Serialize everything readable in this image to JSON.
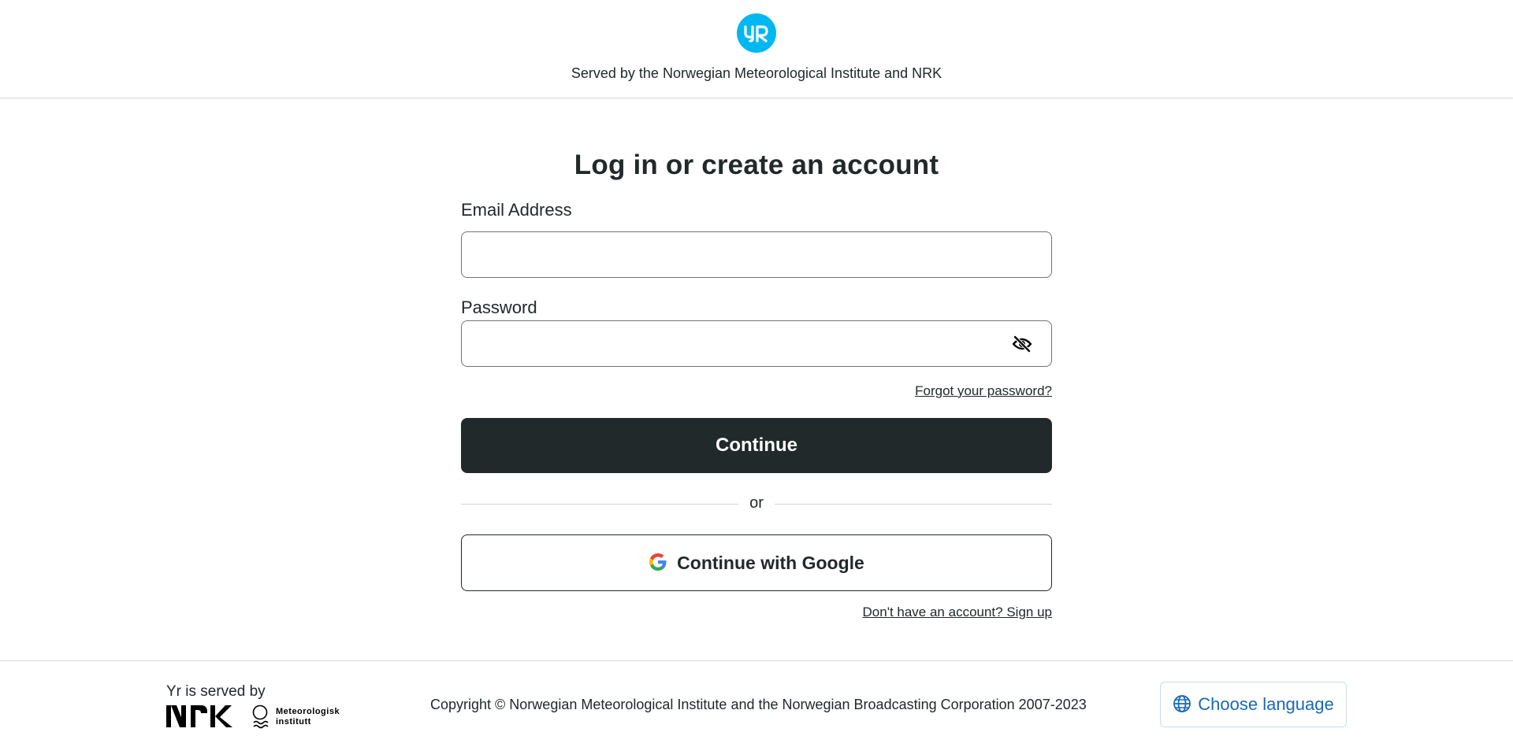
{
  "header": {
    "logo_text": "YR",
    "tagline": "Served by the Norwegian Meteorological Institute and NRK"
  },
  "form": {
    "title": "Log in or create an account",
    "email_label": "Email Address",
    "email_value": "",
    "password_label": "Password",
    "password_value": "",
    "forgot_password": "Forgot your password?",
    "continue_label": "Continue",
    "divider_text": "or",
    "google_label": "Continue with Google",
    "signup_link": "Don't have an account? Sign up"
  },
  "footer": {
    "served_by": "Yr is served by",
    "nrk_logo_text": "NRK",
    "met_logo_text": "Meteorologisk institutt",
    "copyright": "Copyright © Norwegian Meteorological Institute and the Norwegian Broadcasting Corporation 2007-2023",
    "language_button": "Choose language"
  },
  "icons": {
    "logo": "yr-logo",
    "password_toggle": "eye-slash-icon",
    "google": "google-icon",
    "language": "globe-icon"
  },
  "colors": {
    "brand": "#00b8f1",
    "primary_button": "#21292b",
    "link_blue": "#1a69b5",
    "text": "#21292b"
  }
}
